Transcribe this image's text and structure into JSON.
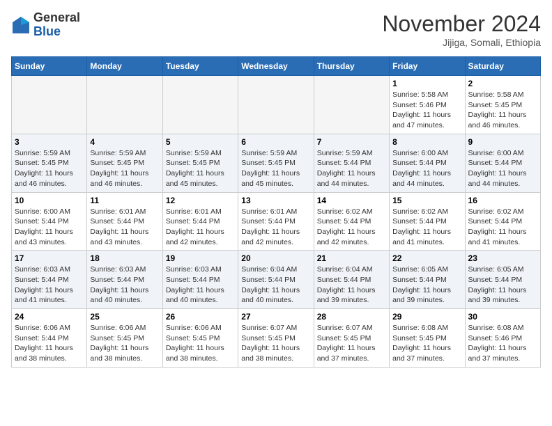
{
  "logo": {
    "general": "General",
    "blue": "Blue"
  },
  "title": "November 2024",
  "subtitle": "Jijiga, Somali, Ethiopia",
  "days_header": [
    "Sunday",
    "Monday",
    "Tuesday",
    "Wednesday",
    "Thursday",
    "Friday",
    "Saturday"
  ],
  "weeks": [
    {
      "row_class": "row-white",
      "days": [
        {
          "num": "",
          "info": "",
          "empty": true
        },
        {
          "num": "",
          "info": "",
          "empty": true
        },
        {
          "num": "",
          "info": "",
          "empty": true
        },
        {
          "num": "",
          "info": "",
          "empty": true
        },
        {
          "num": "",
          "info": "",
          "empty": true
        },
        {
          "num": "1",
          "info": "Sunrise: 5:58 AM\nSunset: 5:46 PM\nDaylight: 11 hours and 47 minutes."
        },
        {
          "num": "2",
          "info": "Sunrise: 5:58 AM\nSunset: 5:45 PM\nDaylight: 11 hours and 46 minutes."
        }
      ]
    },
    {
      "row_class": "row-gray",
      "days": [
        {
          "num": "3",
          "info": "Sunrise: 5:59 AM\nSunset: 5:45 PM\nDaylight: 11 hours and 46 minutes."
        },
        {
          "num": "4",
          "info": "Sunrise: 5:59 AM\nSunset: 5:45 PM\nDaylight: 11 hours and 46 minutes."
        },
        {
          "num": "5",
          "info": "Sunrise: 5:59 AM\nSunset: 5:45 PM\nDaylight: 11 hours and 45 minutes."
        },
        {
          "num": "6",
          "info": "Sunrise: 5:59 AM\nSunset: 5:45 PM\nDaylight: 11 hours and 45 minutes."
        },
        {
          "num": "7",
          "info": "Sunrise: 5:59 AM\nSunset: 5:44 PM\nDaylight: 11 hours and 44 minutes."
        },
        {
          "num": "8",
          "info": "Sunrise: 6:00 AM\nSunset: 5:44 PM\nDaylight: 11 hours and 44 minutes."
        },
        {
          "num": "9",
          "info": "Sunrise: 6:00 AM\nSunset: 5:44 PM\nDaylight: 11 hours and 44 minutes."
        }
      ]
    },
    {
      "row_class": "row-white",
      "days": [
        {
          "num": "10",
          "info": "Sunrise: 6:00 AM\nSunset: 5:44 PM\nDaylight: 11 hours and 43 minutes."
        },
        {
          "num": "11",
          "info": "Sunrise: 6:01 AM\nSunset: 5:44 PM\nDaylight: 11 hours and 43 minutes."
        },
        {
          "num": "12",
          "info": "Sunrise: 6:01 AM\nSunset: 5:44 PM\nDaylight: 11 hours and 42 minutes."
        },
        {
          "num": "13",
          "info": "Sunrise: 6:01 AM\nSunset: 5:44 PM\nDaylight: 11 hours and 42 minutes."
        },
        {
          "num": "14",
          "info": "Sunrise: 6:02 AM\nSunset: 5:44 PM\nDaylight: 11 hours and 42 minutes."
        },
        {
          "num": "15",
          "info": "Sunrise: 6:02 AM\nSunset: 5:44 PM\nDaylight: 11 hours and 41 minutes."
        },
        {
          "num": "16",
          "info": "Sunrise: 6:02 AM\nSunset: 5:44 PM\nDaylight: 11 hours and 41 minutes."
        }
      ]
    },
    {
      "row_class": "row-gray",
      "days": [
        {
          "num": "17",
          "info": "Sunrise: 6:03 AM\nSunset: 5:44 PM\nDaylight: 11 hours and 41 minutes."
        },
        {
          "num": "18",
          "info": "Sunrise: 6:03 AM\nSunset: 5:44 PM\nDaylight: 11 hours and 40 minutes."
        },
        {
          "num": "19",
          "info": "Sunrise: 6:03 AM\nSunset: 5:44 PM\nDaylight: 11 hours and 40 minutes."
        },
        {
          "num": "20",
          "info": "Sunrise: 6:04 AM\nSunset: 5:44 PM\nDaylight: 11 hours and 40 minutes."
        },
        {
          "num": "21",
          "info": "Sunrise: 6:04 AM\nSunset: 5:44 PM\nDaylight: 11 hours and 39 minutes."
        },
        {
          "num": "22",
          "info": "Sunrise: 6:05 AM\nSunset: 5:44 PM\nDaylight: 11 hours and 39 minutes."
        },
        {
          "num": "23",
          "info": "Sunrise: 6:05 AM\nSunset: 5:44 PM\nDaylight: 11 hours and 39 minutes."
        }
      ]
    },
    {
      "row_class": "row-white",
      "days": [
        {
          "num": "24",
          "info": "Sunrise: 6:06 AM\nSunset: 5:44 PM\nDaylight: 11 hours and 38 minutes."
        },
        {
          "num": "25",
          "info": "Sunrise: 6:06 AM\nSunset: 5:45 PM\nDaylight: 11 hours and 38 minutes."
        },
        {
          "num": "26",
          "info": "Sunrise: 6:06 AM\nSunset: 5:45 PM\nDaylight: 11 hours and 38 minutes."
        },
        {
          "num": "27",
          "info": "Sunrise: 6:07 AM\nSunset: 5:45 PM\nDaylight: 11 hours and 38 minutes."
        },
        {
          "num": "28",
          "info": "Sunrise: 6:07 AM\nSunset: 5:45 PM\nDaylight: 11 hours and 37 minutes."
        },
        {
          "num": "29",
          "info": "Sunrise: 6:08 AM\nSunset: 5:45 PM\nDaylight: 11 hours and 37 minutes."
        },
        {
          "num": "30",
          "info": "Sunrise: 6:08 AM\nSunset: 5:46 PM\nDaylight: 11 hours and 37 minutes."
        }
      ]
    }
  ]
}
